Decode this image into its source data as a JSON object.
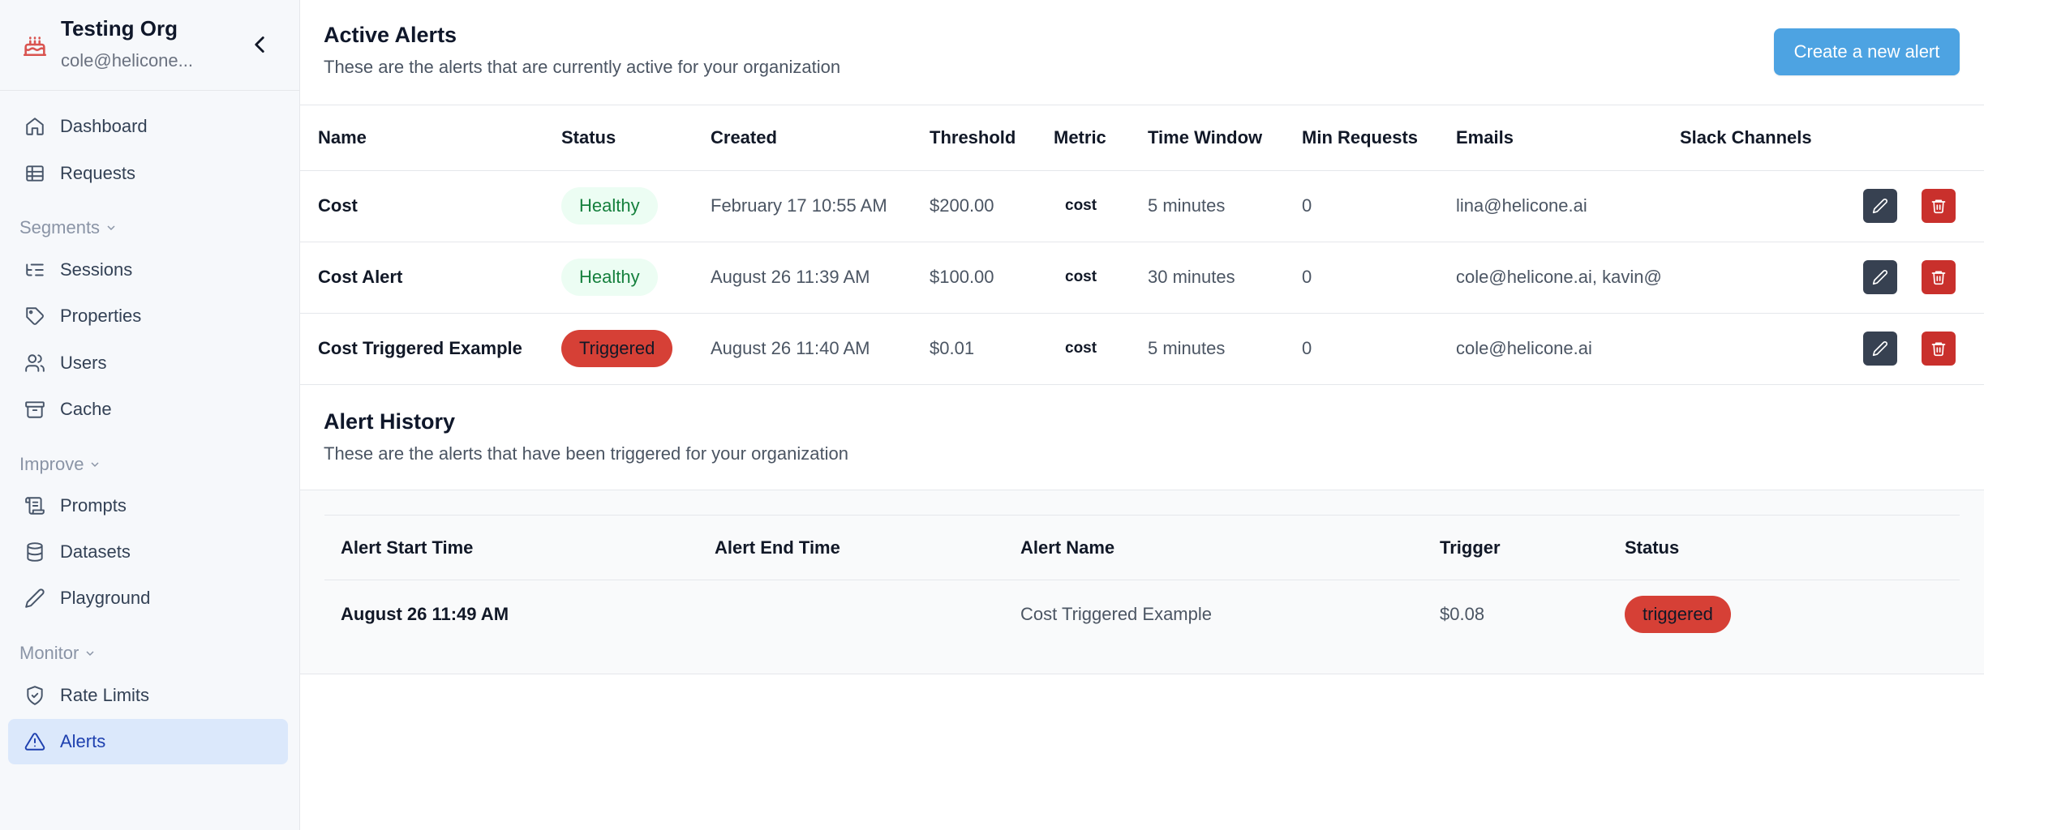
{
  "org": {
    "name": "Testing Org",
    "email": "cole@helicone..."
  },
  "nav": {
    "dashboard": "Dashboard",
    "requests": "Requests",
    "segments": "Segments",
    "sessions": "Sessions",
    "properties": "Properties",
    "users": "Users",
    "cache": "Cache",
    "improve": "Improve",
    "prompts": "Prompts",
    "datasets": "Datasets",
    "playground": "Playground",
    "monitor": "Monitor",
    "rate_limits": "Rate Limits",
    "alerts": "Alerts"
  },
  "active": {
    "title": "Active Alerts",
    "subtitle": "These are the alerts that are currently active for your organization",
    "create_label": "Create a new alert",
    "columns": [
      "Name",
      "Status",
      "Created",
      "Threshold",
      "Metric",
      "Time Window",
      "Min Requests",
      "Emails",
      "Slack Channels"
    ],
    "rows": [
      {
        "name": "Cost",
        "status": "Healthy",
        "created": "February 17 10:55 AM",
        "threshold": "$200.00",
        "metric": "cost",
        "window": "5 minutes",
        "min": "0",
        "emails": "lina@helicone.ai",
        "slack": ""
      },
      {
        "name": "Cost Alert",
        "status": "Healthy",
        "created": "August 26 11:39 AM",
        "threshold": "$100.00",
        "metric": "cost",
        "window": "30 minutes",
        "min": "0",
        "emails": "cole@helicone.ai, kavin@",
        "slack": ""
      },
      {
        "name": "Cost Triggered Example",
        "status": "Triggered",
        "created": "August 26 11:40 AM",
        "threshold": "$0.01",
        "metric": "cost",
        "window": "5 minutes",
        "min": "0",
        "emails": "cole@helicone.ai",
        "slack": ""
      }
    ]
  },
  "history": {
    "title": "Alert History",
    "subtitle": "These are the alerts that have been triggered for your organization",
    "columns": [
      "Alert Start Time",
      "Alert End Time",
      "Alert Name",
      "Trigger",
      "Status"
    ],
    "rows": [
      {
        "start": "August 26 11:49 AM",
        "end": "",
        "name": "Cost Triggered Example",
        "trigger": "$0.08",
        "status": "triggered"
      }
    ]
  },
  "colors": {
    "accent": "#4da3e2",
    "healthy_bg": "#ecfdf3",
    "healthy_text": "#15803d",
    "triggered": "#d64036",
    "active_nav_bg": "#dbe8fb"
  }
}
